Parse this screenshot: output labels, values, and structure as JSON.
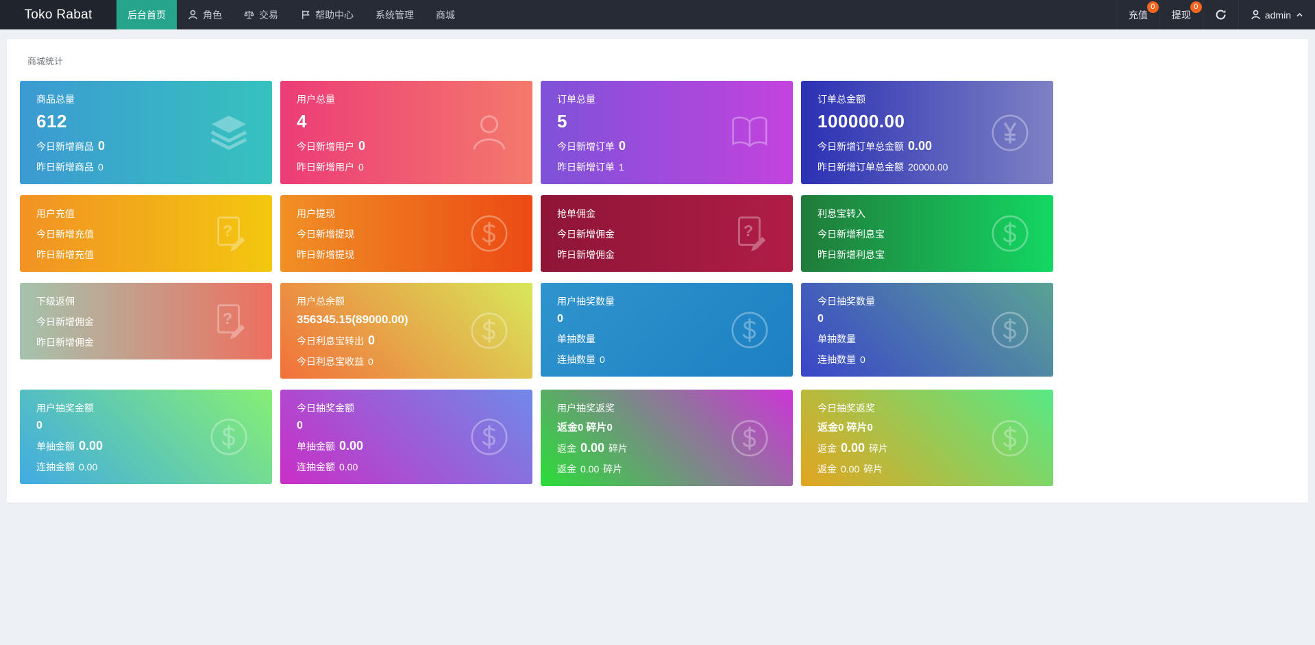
{
  "navbar": {
    "logo": "Toko Rabat",
    "accent": "#26a58c",
    "badge_color": "#f4661f",
    "menu": [
      {
        "label": "后台首页",
        "icon": "",
        "active": true
      },
      {
        "label": "角色",
        "icon": "user-small-icon",
        "active": false
      },
      {
        "label": "交易",
        "icon": "scales-icon",
        "active": false
      },
      {
        "label": "帮助中心",
        "icon": "flag-icon",
        "active": false
      },
      {
        "label": "系统管理",
        "icon": "",
        "active": false
      },
      {
        "label": "商城",
        "icon": "",
        "active": false
      }
    ],
    "recharge_label": "充值",
    "recharge_badge": "0",
    "withdraw_label": "提现",
    "withdraw_badge": "0",
    "username": "admin"
  },
  "section_title": "商城统计",
  "cards": [
    {
      "title": "商品总量",
      "big": "612",
      "big_size": "xl",
      "icon": "layers-icon",
      "gradient": {
        "dir": "to right",
        "from": "#3c9ad2",
        "to": "#36c2be"
      },
      "lines": [
        {
          "pre": "今日新增商品",
          "value": "0",
          "suf": "",
          "emph": true
        },
        {
          "pre": "昨日新增商品",
          "value": "0",
          "suf": "",
          "emph": false
        }
      ]
    },
    {
      "title": "用户总量",
      "big": "4",
      "big_size": "xl",
      "icon": "person-icon",
      "gradient": {
        "dir": "to right",
        "from": "#ec3c77",
        "to": "#f4796c"
      },
      "lines": [
        {
          "pre": "今日新增用户",
          "value": "0",
          "suf": "",
          "emph": true
        },
        {
          "pre": "昨日新增用户",
          "value": "0",
          "suf": "",
          "emph": false
        }
      ]
    },
    {
      "title": "订单总量",
      "big": "5",
      "big_size": "xl",
      "icon": "book-icon",
      "gradient": {
        "dir": "to right",
        "from": "#7e52d8",
        "to": "#c343de"
      },
      "lines": [
        {
          "pre": "今日新增订单",
          "value": "0",
          "suf": "",
          "emph": true
        },
        {
          "pre": "昨日新增订单",
          "value": "1",
          "suf": "",
          "emph": false
        }
      ]
    },
    {
      "title": "订单总金额",
      "big": "100000.00",
      "big_size": "xl",
      "icon": "yen-circle-icon",
      "gradient": {
        "dir": "to right",
        "from": "#2b31b4",
        "to": "#7e81c3"
      },
      "lines": [
        {
          "pre": "今日新增订单总金额",
          "value": "0.00",
          "suf": "",
          "emph": true
        },
        {
          "pre": "昨日新增订单总金额",
          "value": "20000.00",
          "suf": "",
          "emph": false
        }
      ]
    },
    {
      "title": "用户充值",
      "big": "",
      "big_size": "",
      "icon": "doc-question-icon",
      "gradient": {
        "dir": "to right",
        "from": "#f29224",
        "to": "#f3c70f"
      },
      "lines": [
        {
          "pre": "今日新增充值",
          "value": "",
          "suf": "",
          "emph": false
        },
        {
          "pre": "昨日新增充值",
          "value": "",
          "suf": "",
          "emph": false
        }
      ]
    },
    {
      "title": "用户提现",
      "big": "",
      "big_size": "",
      "icon": "dollar-circle-icon",
      "gradient": {
        "dir": "to right",
        "from": "#f09025",
        "to": "#ec4a14"
      },
      "lines": [
        {
          "pre": "今日新增提现",
          "value": "",
          "suf": "",
          "emph": false
        },
        {
          "pre": "昨日新增提现",
          "value": "",
          "suf": "",
          "emph": false
        }
      ]
    },
    {
      "title": "抢单佣金",
      "big": "",
      "big_size": "",
      "icon": "doc-question-icon",
      "gradient": {
        "dir": "to right",
        "from": "#8e1536",
        "to": "#b01d45"
      },
      "lines": [
        {
          "pre": "今日新增佣金",
          "value": "",
          "suf": "",
          "emph": false
        },
        {
          "pre": "昨日新增佣金",
          "value": "",
          "suf": "",
          "emph": false
        }
      ]
    },
    {
      "title": "利息宝转入",
      "big": "",
      "big_size": "",
      "icon": "dollar-circle-icon",
      "gradient": {
        "dir": "to right",
        "from": "#207b3a",
        "to": "#13d763"
      },
      "lines": [
        {
          "pre": "今日新增利息宝",
          "value": "",
          "suf": "",
          "emph": false
        },
        {
          "pre": "昨日新增利息宝",
          "value": "",
          "suf": "",
          "emph": false
        }
      ]
    },
    {
      "title": "下级返佣",
      "big": "",
      "big_size": "",
      "icon": "doc-question-icon",
      "gradient": {
        "dir": "to right",
        "from": "#a4c3ad",
        "to": "#ee6f5f"
      },
      "lines": [
        {
          "pre": "今日新增佣金",
          "value": "",
          "suf": "",
          "emph": false
        },
        {
          "pre": "昨日新增佣金",
          "value": "",
          "suf": "",
          "emph": false
        }
      ]
    },
    {
      "title": "用户总余额",
      "big": "356345.15(89000.00)",
      "big_size": "lg",
      "icon": "dollar-circle-icon",
      "gradient": {
        "dir": "45deg",
        "from": "#f2703a",
        "to": "#d8e75a"
      },
      "lines": [
        {
          "pre": "今日利息宝转出",
          "value": "0",
          "suf": "",
          "emph": true
        },
        {
          "pre": "今日利息宝收益",
          "value": "0",
          "suf": "",
          "emph": false
        }
      ]
    },
    {
      "title": "用户抽奖数量",
      "big": "0",
      "big_size": "md",
      "icon": "dollar-circle-icon",
      "gradient": {
        "dir": "135deg",
        "from": "#2f94cd",
        "to": "#1c80c2"
      },
      "lines": [
        {
          "pre": "单抽数量",
          "value": "",
          "suf": "",
          "emph": false
        },
        {
          "pre": "连抽数量",
          "value": "0",
          "suf": "",
          "emph": false
        }
      ]
    },
    {
      "title": "今日抽奖数量",
      "big": "0",
      "big_size": "md",
      "icon": "dollar-circle-icon",
      "gradient": {
        "dir": "45deg",
        "from": "#3a45c9",
        "to": "#5aa394"
      },
      "lines": [
        {
          "pre": "单抽数量",
          "value": "",
          "suf": "",
          "emph": false
        },
        {
          "pre": "连抽数量",
          "value": "0",
          "suf": "",
          "emph": false
        }
      ]
    },
    {
      "title": "用户抽奖金额",
      "big": "0",
      "big_size": "md",
      "icon": "dollar-circle-icon",
      "gradient": {
        "dir": "45deg",
        "from": "#41abe3",
        "to": "#86ef74"
      },
      "lines": [
        {
          "pre": "单抽金额",
          "value": "0.00",
          "suf": "",
          "emph": true
        },
        {
          "pre": "连抽金额",
          "value": "0.00",
          "suf": "",
          "emph": false
        }
      ]
    },
    {
      "title": "今日抽奖金额",
      "big": "0",
      "big_size": "md",
      "icon": "dollar-circle-icon",
      "gradient": {
        "dir": "45deg",
        "from": "#c92fc5",
        "to": "#7089e8"
      },
      "lines": [
        {
          "pre": "单抽金额",
          "value": "0.00",
          "suf": "",
          "emph": true
        },
        {
          "pre": "连抽金额",
          "value": "0.00",
          "suf": "",
          "emph": false
        }
      ]
    },
    {
      "title": "用户抽奖返奖",
      "big": "返金0 碎片0",
      "big_size": "sm",
      "icon": "dollar-circle-icon",
      "gradient": {
        "dir": "45deg",
        "from": "#2bdd38",
        "to": "#cd35d8"
      },
      "lines": [
        {
          "pre": "返金",
          "value": "0.00",
          "suf": "碎片",
          "emph": true
        },
        {
          "pre": "返金",
          "value": "0.00",
          "suf": "碎片",
          "emph": false
        }
      ]
    },
    {
      "title": "今日抽奖返奖",
      "big": "返金0 碎片0",
      "big_size": "sm",
      "icon": "dollar-circle-icon",
      "gradient": {
        "dir": "45deg",
        "from": "#e2a51f",
        "to": "#57e985"
      },
      "lines": [
        {
          "pre": "返金",
          "value": "0.00",
          "suf": "碎片",
          "emph": true
        },
        {
          "pre": "返金",
          "value": "0.00",
          "suf": "碎片",
          "emph": false
        }
      ]
    }
  ]
}
